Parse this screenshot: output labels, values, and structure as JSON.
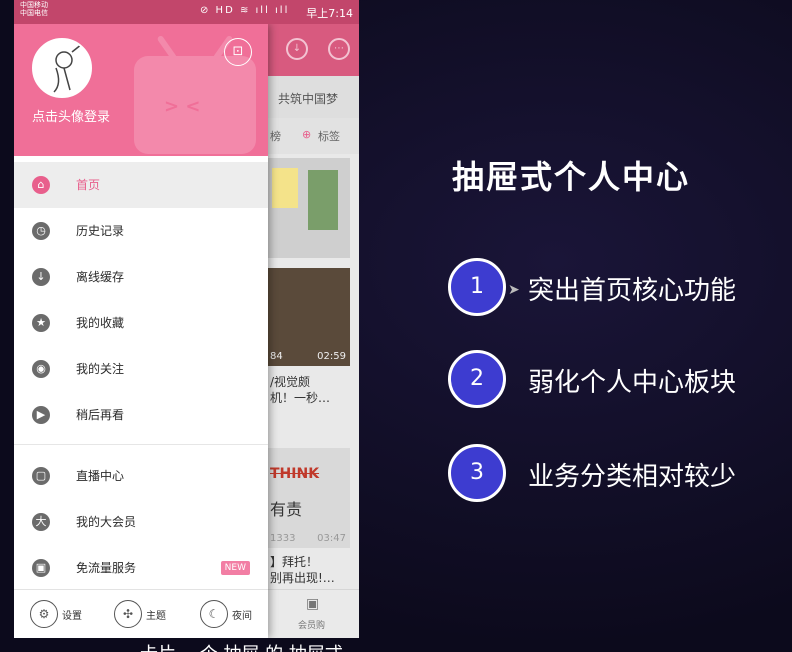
{
  "status_bar": {
    "carrier_1": "中国移动",
    "carrier_2": "中国电信",
    "icons": "⊘ HD ≋ ıll ıll",
    "time": "早上7:14"
  },
  "drawer": {
    "login_text": "点击头像登录",
    "scan_icon": "scan-icon",
    "menu_group_1": [
      {
        "label": "首页",
        "icon": "home-icon",
        "glyph": "⌂",
        "active": true
      },
      {
        "label": "历史记录",
        "icon": "clock-icon",
        "glyph": "◷"
      },
      {
        "label": "离线缓存",
        "icon": "cloud-download-icon",
        "glyph": "↓"
      },
      {
        "label": "我的收藏",
        "icon": "star-icon",
        "glyph": "★"
      },
      {
        "label": "我的关注",
        "icon": "target-icon",
        "glyph": "◉"
      },
      {
        "label": "稍后再看",
        "icon": "play-later-icon",
        "glyph": "▶"
      }
    ],
    "menu_group_2": [
      {
        "label": "直播中心",
        "icon": "live-tv-icon",
        "glyph": "▢"
      },
      {
        "label": "我的大会员",
        "icon": "vip-icon",
        "glyph": "大"
      },
      {
        "label": "免流量服务",
        "icon": "sim-card-icon",
        "glyph": "▣",
        "badge": "NEW"
      }
    ],
    "footer": [
      {
        "label": "设置",
        "icon": "settings-icon",
        "glyph": "⚙"
      },
      {
        "label": "主题",
        "icon": "theme-icon",
        "glyph": "✣"
      },
      {
        "label": "夜间",
        "icon": "night-mode-icon",
        "glyph": "☾"
      }
    ]
  },
  "background_app": {
    "header_text": "共筑中国梦",
    "tab_1": "榜",
    "tab_2": "标签",
    "duration_1": "84",
    "duration_2": "02:59",
    "card_text_1": "/视觉颇",
    "card_text_2": "机！一秒…",
    "think_text": "THINK",
    "card_text_3": "有责",
    "duration_3": "1333",
    "duration_4": "03:47",
    "card_text_4": "】拜托！",
    "card_text_5": "别再出现!…",
    "nav_label": "会员购"
  },
  "slide": {
    "title": "抽屉式个人中心",
    "points": [
      {
        "number": "1",
        "text": "突出首页核心功能"
      },
      {
        "number": "2",
        "text": "弱化个人中心板块"
      },
      {
        "number": "3",
        "text": "业务分类相对较少"
      }
    ],
    "subtitle": "卡片 一个 抽屉 的 抽屉式"
  },
  "colors": {
    "accent_pink": "#f06f98",
    "active_pink": "#e85f8c",
    "point_blue": "#3d3cd0",
    "background": "#0d0a1e"
  }
}
